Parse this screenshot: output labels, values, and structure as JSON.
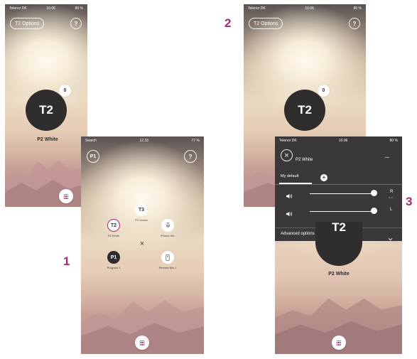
{
  "colors": {
    "accent": "#b0247a",
    "dark": "#2f2d2e",
    "panel": "#3b3839"
  },
  "steps": {
    "one": "1",
    "two": "2",
    "three": "3"
  },
  "screen_a": {
    "status": {
      "carrier": "Telenor DK",
      "time": "10.06",
      "battery": "80 %"
    },
    "options_label": "T2 Options",
    "help_label": "?",
    "program": {
      "label": "T2",
      "badge": "0",
      "name": "P2 White"
    },
    "grid_icon": "grid-icon"
  },
  "screen_b": {
    "status": {
      "carrier": "Telenor DK",
      "time": "10.06",
      "battery": "80 %"
    },
    "options_label": "T2 Options",
    "help_label": "?",
    "program": {
      "label": "T2",
      "badge": "0"
    }
  },
  "screen_1": {
    "status": {
      "carrier": "Search",
      "time": "12.33",
      "battery": "77 %"
    },
    "current_label": "P1",
    "help_label": "?",
    "items": [
      {
        "label": "T3",
        "name": "P3 Ocean"
      },
      {
        "label": "T2",
        "name": "P2 White",
        "selected": true
      },
      {
        "label": "",
        "name": "iPhone Mic",
        "icon": "microphone-icon"
      },
      {
        "label": "P1",
        "name": "Program 1",
        "dark": true
      },
      {
        "label": "",
        "name": "Remote Mic 1",
        "icon": "remote-mic-icon"
      }
    ],
    "close_glyph": "×"
  },
  "screen_3": {
    "status": {
      "carrier": "Telenor DK",
      "time": "10.06",
      "battery": "80 %"
    },
    "close_glyph": "×",
    "program_name": "P2 White",
    "more_glyph": "...",
    "tab_label": "My default",
    "add_glyph": "+",
    "volume_right": {
      "side": "R",
      "level": 1.0
    },
    "volume_left": {
      "side": "L",
      "level": 1.0
    },
    "link_glyph": "< >",
    "advanced_label": "Advanced options",
    "program": {
      "label": "T2",
      "name": "P2 White"
    }
  }
}
